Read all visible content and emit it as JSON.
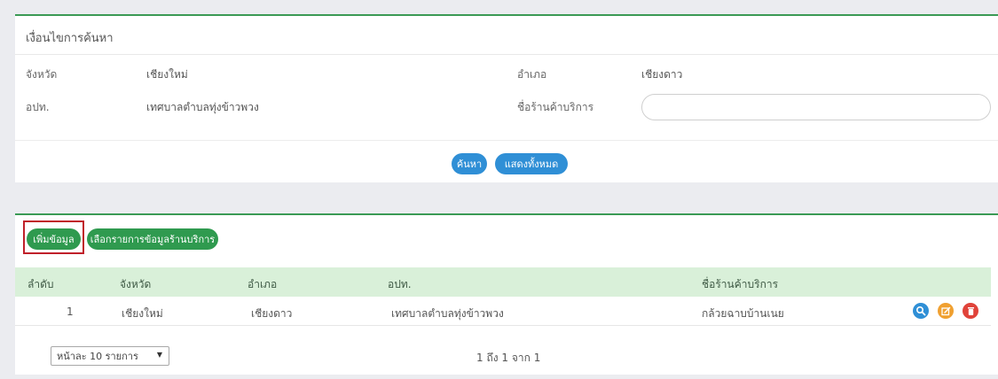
{
  "search": {
    "title": "เงื่อนไขการค้นหา",
    "province_label": "จังหวัด",
    "province_value": "เชียงใหม่",
    "district_label": "อำเภอ",
    "district_value": "เชียงดาว",
    "lao_label": "อปท.",
    "lao_value": "เทศบาลตำบลทุ่งข้าวพวง",
    "shop_label": "ชื่อร้านค้าบริการ",
    "shop_value": "",
    "search_button": "ค้นหา",
    "show_all_button": "แสดงทั้งหมด"
  },
  "colors": {
    "accent_green": "#2f9a4f",
    "accent_blue": "#2f8fd6",
    "header_row": "#d9f0d9",
    "highlight_red": "#c0202a"
  },
  "results": {
    "add_button": "เพิ่มข้อมูล",
    "select_shop_button": "เลือกรายการข้อมูลร้านบริการ",
    "columns": [
      "ลำดับ",
      "จังหวัด",
      "อำเภอ",
      "อปท.",
      "ชื่อร้านค้าบริการ"
    ],
    "rows": [
      {
        "index": "1",
        "province": "เชียงใหม่",
        "district": "เชียงดาว",
        "lao": "เทศบาลตำบลทุ่งข้าวพวง",
        "shop": "กล้วยฉาบบ้านเนย",
        "actions": [
          "search-icon",
          "edit-icon",
          "trash-icon"
        ]
      }
    ],
    "page_size_label": "หน้าละ 10 รายการ",
    "page_info": "1 ถึง 1 จาก 1"
  }
}
